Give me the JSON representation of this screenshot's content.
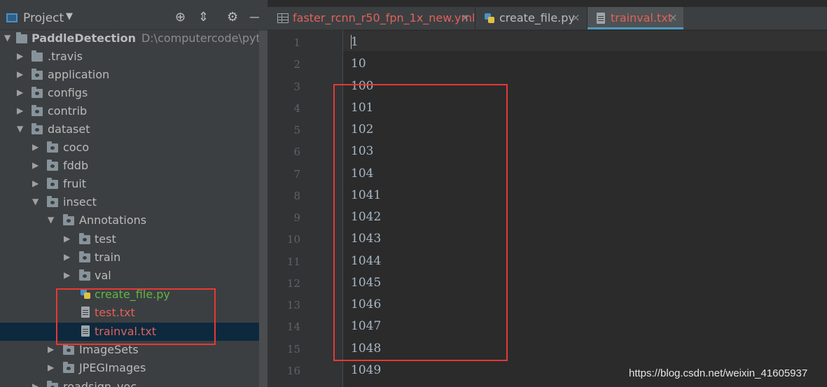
{
  "project_panel": {
    "title": "Project",
    "tree": [
      {
        "label": "PaddleDetection",
        "path": "D:\\computercode\\python\\Pa",
        "bold": true
      },
      {
        "label": ".travis"
      },
      {
        "label": "application"
      },
      {
        "label": "configs"
      },
      {
        "label": "contrib"
      },
      {
        "label": "dataset"
      },
      {
        "label": "coco"
      },
      {
        "label": "fddb"
      },
      {
        "label": "fruit"
      },
      {
        "label": "insect"
      },
      {
        "label": "Annotations"
      },
      {
        "label": "test"
      },
      {
        "label": "train"
      },
      {
        "label": "val"
      },
      {
        "label": "create_file.py"
      },
      {
        "label": "test.txt"
      },
      {
        "label": "trainval.txt"
      },
      {
        "label": "ImageSets"
      },
      {
        "label": "JPEGImages"
      },
      {
        "label": "roadsign_voc"
      }
    ]
  },
  "tabs": [
    {
      "label": "faster_rcnn_r50_fpn_1x_new.yml"
    },
    {
      "label": "create_file.py"
    },
    {
      "label": "trainval.txt"
    }
  ],
  "tab_close_glyph": "×",
  "editor": {
    "line_numbers": [
      "1",
      "2",
      "3",
      "4",
      "5",
      "6",
      "7",
      "8",
      "9",
      "10",
      "11",
      "12",
      "13",
      "14",
      "15",
      "16"
    ],
    "lines": [
      "1",
      "10",
      "100",
      "101",
      "102",
      "103",
      "104",
      "1041",
      "1042",
      "1043",
      "1044",
      "1045",
      "1046",
      "1047",
      "1048",
      "1049"
    ]
  },
  "watermark": "https://blog.csdn.net/weixin_41605937",
  "colors": {
    "highlight_box": "#e53935",
    "modified_file": "#e0615a",
    "new_file": "#62b543",
    "active_tab_underline": "#4a9bbf"
  },
  "icons": {
    "project_tools": [
      "crosshair-icon",
      "collapse-icon",
      "gear-icon",
      "minimize-icon"
    ]
  }
}
